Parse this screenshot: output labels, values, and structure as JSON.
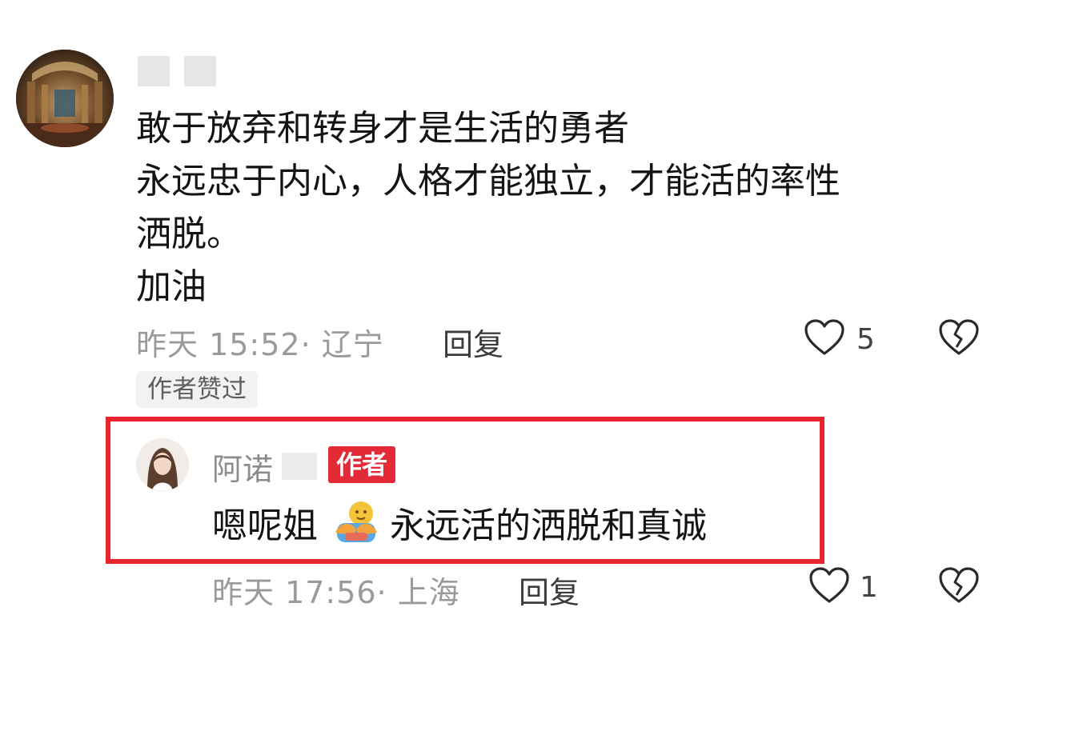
{
  "comment": {
    "avatar_icon": "building-interior-avatar",
    "text_lines": [
      "敢于放弃和转身才是生活的勇者",
      "永远忠于内心，人格才能独立，才能活的率性",
      "洒脱。",
      "加油"
    ],
    "meta": "昨天 15:52· 辽宁",
    "reply_label": "回复",
    "like_count": "5",
    "liked_by_author_tag": "作者赞过"
  },
  "author_reply": {
    "name": "阿诺",
    "badge": "作者",
    "text_before_emoji": "嗯呢姐",
    "emoji": "hug-emoji",
    "text_after_emoji": "永远活的洒脱和真诚",
    "meta": "昨天 17:56· 上海",
    "reply_label": "回复",
    "like_count": "1"
  },
  "colors": {
    "highlight_border": "#e8242e",
    "author_badge": "#e32a36",
    "meta_text": "#9a9a9a"
  }
}
